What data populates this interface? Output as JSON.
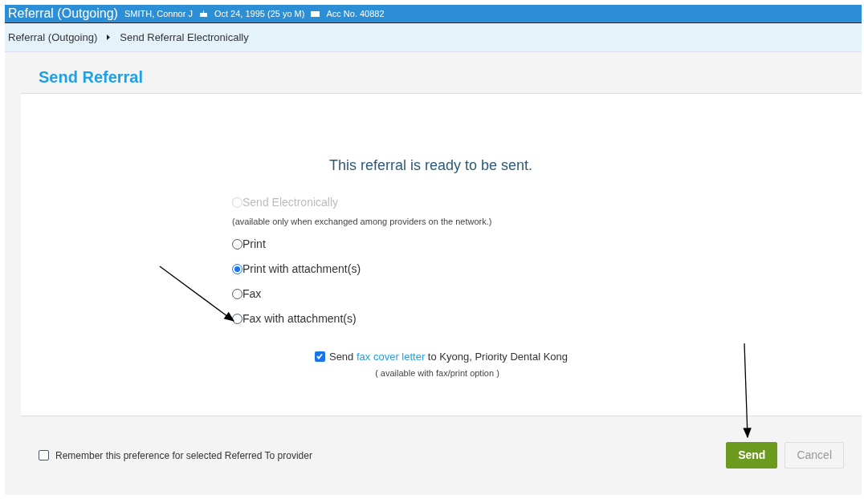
{
  "header": {
    "title": "Referral (Outgoing)",
    "patient": "SMITH, Connor J",
    "birth_date": "Oct 24, 1995 (25 yo M)",
    "account": "Acc No. 40882"
  },
  "breadcrumb": [
    "Referral (Outgoing)",
    "Send Referral Electronically"
  ],
  "panel": {
    "title": "Send Referral",
    "message": "This referral is ready to be sent.",
    "options": [
      {
        "label": "Send Electronically",
        "selected": false,
        "disabled": true,
        "note": "(available only when exchanged among providers on the network.)"
      },
      {
        "label": "Print",
        "selected": false,
        "disabled": false
      },
      {
        "label": "Print with attachment(s)",
        "selected": true,
        "disabled": false
      },
      {
        "label": "Fax",
        "selected": false,
        "disabled": false
      },
      {
        "label": "Fax with attachment(s)",
        "selected": false,
        "disabled": false
      }
    ],
    "cover_letter": {
      "checked": true,
      "before": "Send",
      "link": "fax cover letter",
      "after": "to Kyong, Priority Dental Kong",
      "note": "( available with fax/print option )"
    }
  },
  "footer": {
    "remember": {
      "label": "Remember this preference for selected Referred To provider",
      "checked": false
    },
    "buttons": [
      {
        "label": "Send",
        "kind": "primary",
        "disabled": false
      },
      {
        "label": "Cancel",
        "kind": "secondary",
        "disabled": true
      }
    ]
  }
}
